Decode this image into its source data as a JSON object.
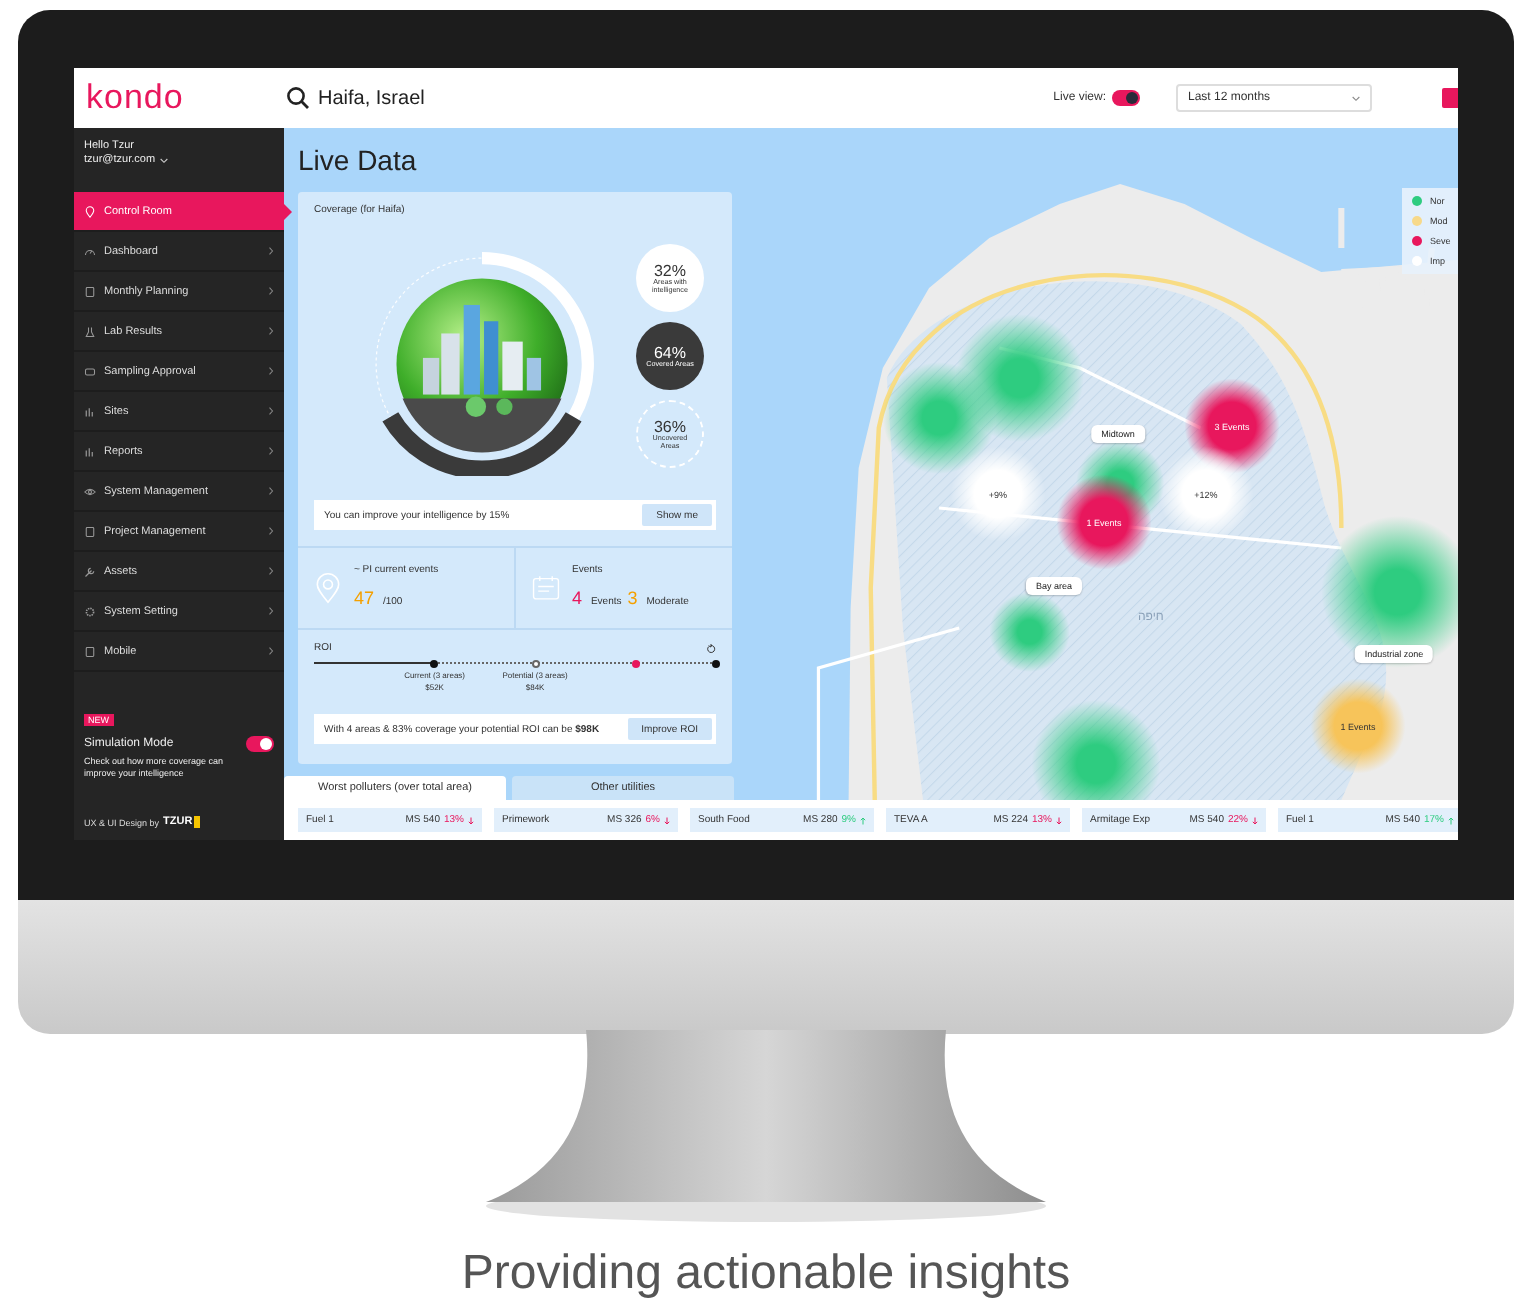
{
  "header": {
    "logo": "kondo",
    "search": {
      "value": "Haifa, Israel"
    },
    "live_view": {
      "label": "Live view:",
      "on": true
    },
    "period": {
      "value": "Last 12 months"
    }
  },
  "user": {
    "greeting": "Hello Tzur",
    "email": "tzur@tzur.com"
  },
  "sidebar": {
    "items": [
      {
        "label": "Control Room",
        "selected": true
      },
      {
        "label": "Dashboard",
        "selected": false
      },
      {
        "label": "Monthly Planning",
        "selected": false
      },
      {
        "label": "Lab Results",
        "selected": false
      },
      {
        "label": "Sampling Approval",
        "selected": false
      },
      {
        "label": "Sites",
        "selected": false
      },
      {
        "label": "Reports",
        "selected": false
      },
      {
        "label": "System Management",
        "selected": false
      },
      {
        "label": "Project Management",
        "selected": false
      },
      {
        "label": "Assets",
        "selected": false
      },
      {
        "label": "System Setting",
        "selected": false
      },
      {
        "label": "Mobile",
        "selected": false
      }
    ]
  },
  "simulation": {
    "badge": "NEW",
    "title": "Simulation Mode",
    "on": true,
    "description": "Check out how more coverage can improve your intelligence"
  },
  "credit": {
    "text": "UX & UI Design by",
    "logo": "TZUR"
  },
  "page_title": "Live Data",
  "coverage": {
    "title": "Coverage (for Haifa)",
    "stats": [
      {
        "value": "32%",
        "label": "Areas with intelligence",
        "kind": "light"
      },
      {
        "value": "64%",
        "label": "Covered Areas",
        "kind": "dark"
      },
      {
        "value": "36%",
        "label": "Uncovered Areas",
        "kind": "dashed"
      }
    ],
    "tip": "You can improve your intelligence by 15%",
    "tip_button": "Show me"
  },
  "pi": {
    "label": "~ PI current events",
    "value": "47",
    "total": "/100"
  },
  "events": {
    "label": "Events",
    "count": "4",
    "count_label": "Events",
    "moderate": "3",
    "moderate_label": "Moderate"
  },
  "roi": {
    "label": "ROI",
    "level": 0.3,
    "markers": [
      {
        "label": "Current (3 areas)",
        "value": "$52K",
        "kind": "current"
      },
      {
        "label": "Potential (3 areas)",
        "value": "$84K",
        "kind": "potential"
      }
    ],
    "note": "With 4 areas & 83% coverage your potential ROI can be **$98K**",
    "button": "Improve ROI"
  },
  "tabs": [
    {
      "label": "Worst polluters (over total area)",
      "selected": true
    },
    {
      "label": "Other utilities",
      "selected": false
    }
  ],
  "ticker": [
    {
      "name": "Fuel 1",
      "value": "MS 540",
      "change": "13%",
      "falling": true
    },
    {
      "name": "Primework",
      "value": "MS 326",
      "change": "6%",
      "falling": true
    },
    {
      "name": "South Food",
      "value": "MS 280",
      "change": "9%",
      "falling": false
    },
    {
      "name": "TEVA A",
      "value": "MS 224",
      "change": "13%",
      "falling": true
    },
    {
      "name": "Armitage Exp",
      "value": "MS 540",
      "change": "22%",
      "falling": true
    },
    {
      "name": "Fuel 1",
      "value": "MS 540",
      "change": "17%",
      "falling": false
    }
  ],
  "map": {
    "city": "חיפה",
    "hotspots": [
      {
        "text": "3 Events",
        "kind": "severe"
      },
      {
        "text": "1 Events",
        "kind": "severe"
      },
      {
        "text": "1 Events",
        "kind": "moderate"
      },
      {
        "text": "+9%",
        "kind": "improvement"
      },
      {
        "text": "+12%",
        "kind": "improvement"
      }
    ],
    "areas": [
      "Midtown",
      "Bay area",
      "Industrial zone"
    ],
    "legend": [
      {
        "label": "Nor",
        "color": "#2ecc80"
      },
      {
        "label": "Mod",
        "color": "#f7d98a"
      },
      {
        "label": "Seve",
        "color": "#e8175d"
      },
      {
        "label": "Imp",
        "color": "#ffffff"
      }
    ]
  },
  "caption": "Providing actionable insights"
}
